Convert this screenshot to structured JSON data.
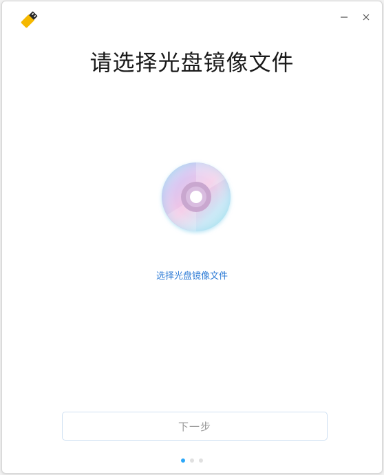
{
  "window": {
    "minimize_glyph": "–",
    "close_glyph": "×"
  },
  "main": {
    "title": "请选择光盘镜像文件",
    "select_link": "选择光盘镜像文件",
    "next_button": "下一步"
  },
  "pagination": {
    "total": 3,
    "current": 1
  },
  "icons": {
    "app": "usb-drive-icon",
    "disc": "optical-disc-icon"
  },
  "colors": {
    "link": "#2f7cd6",
    "active_dot": "#2ca7f8",
    "button_border": "#cfe0f2",
    "app_icon_yellow": "#f5b800"
  }
}
